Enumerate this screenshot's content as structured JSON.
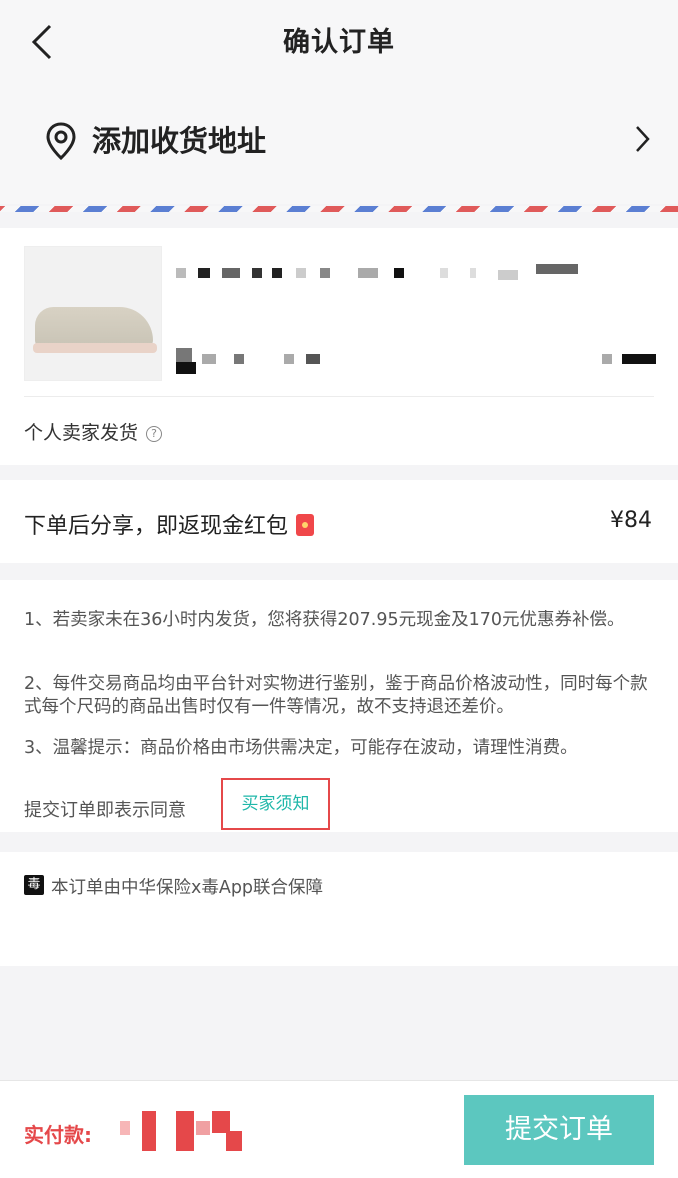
{
  "header": {
    "title": "确认订单",
    "back_icon": "chevron-left-icon"
  },
  "address": {
    "label": "添加收货地址",
    "icon": "location-pin-icon",
    "arrow_icon": "chevron-right-icon"
  },
  "product": {
    "seller_text": "个人卖家发货",
    "help_icon": "question-circle-icon"
  },
  "share": {
    "text": "下单后分享，即返现金红包",
    "amount": "¥84",
    "icon": "red-envelope-icon"
  },
  "notice": {
    "item1": "1、若卖家未在36小时内发货，您将获得207.95元现金及170元优惠券补偿。",
    "item2": "2、每件交易商品均由平台针对实物进行鉴别，鉴于商品价格波动性，同时每个款式每个尺码的商品出售时仅有一件等情况，故不支持退还差价。",
    "item3": "3、温馨提示：商品价格由市场供需决定，可能存在波动，请理性消费。",
    "agree_text": "提交订单即表示同意",
    "buyer_link": "买家须知"
  },
  "insurance": {
    "icon_glyph": "毒",
    "text": "本订单由中华保险x毒App联合保障"
  },
  "footer": {
    "pay_label": "实付款:",
    "submit_label": "提交订单"
  },
  "colors": {
    "accent": "#5cc7bf",
    "link": "#1fb7a9",
    "red": "#e5484a"
  }
}
